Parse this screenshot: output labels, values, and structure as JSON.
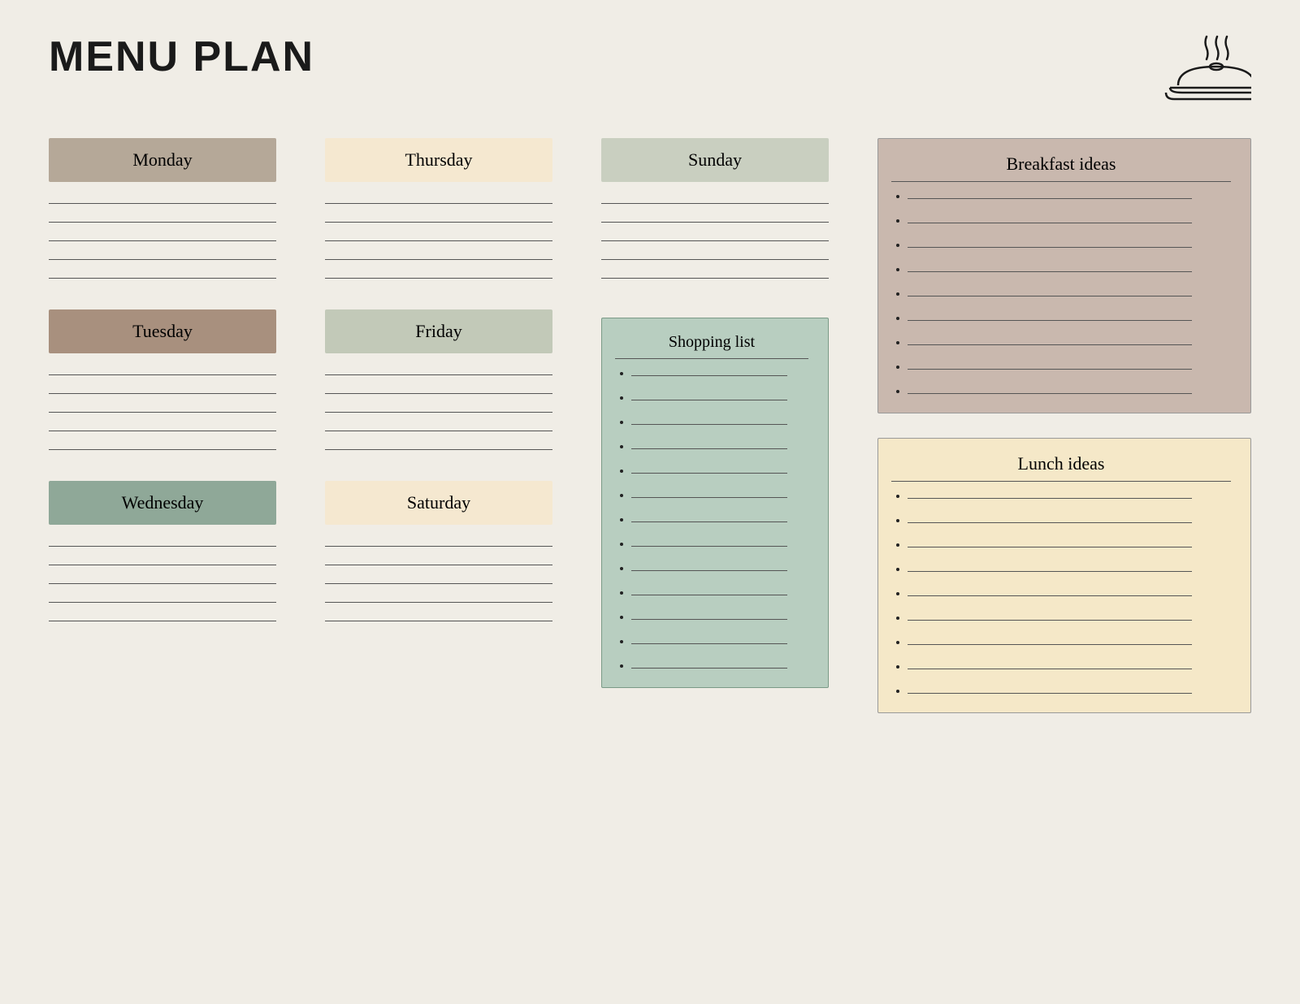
{
  "header": {
    "title": "MENU PLAN"
  },
  "days": {
    "monday": {
      "label": "Monday",
      "color_class": "monday-bg",
      "lines": 5
    },
    "tuesday": {
      "label": "Tuesday",
      "color_class": "tuesday-bg",
      "lines": 5
    },
    "wednesday": {
      "label": "Wednesday",
      "color_class": "wednesday-bg",
      "lines": 5
    },
    "thursday": {
      "label": "Thursday",
      "color_class": "thursday-bg",
      "lines": 5
    },
    "friday": {
      "label": "Friday",
      "color_class": "friday-bg",
      "lines": 5
    },
    "saturday": {
      "label": "Saturday",
      "color_class": "saturday-bg",
      "lines": 5
    },
    "sunday": {
      "label": "Sunday",
      "color_class": "sunday-bg",
      "lines": 5
    }
  },
  "shopping_list": {
    "title": "Shopping list",
    "items": 13
  },
  "breakfast_ideas": {
    "title": "Breakfast ideas",
    "items": 9
  },
  "lunch_ideas": {
    "title": "Lunch ideas",
    "items": 9
  }
}
